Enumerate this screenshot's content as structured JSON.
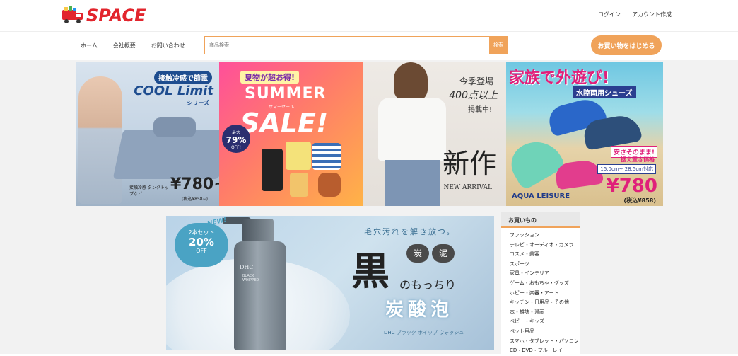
{
  "header": {
    "logo_text": "SPACE",
    "login": "ログイン",
    "create_account": "アカウント作成"
  },
  "nav": {
    "items": [
      "ホーム",
      "会社概要",
      "お問い合わせ"
    ]
  },
  "search": {
    "placeholder": "商品検索",
    "button": "検索"
  },
  "cta": {
    "label": "お買い物をはじめる"
  },
  "banners": [
    {
      "name": "COOL Limit",
      "tag": "接触冷感で節電",
      "title": "COOL Limit",
      "series": "シリーズ",
      "item": "接触冷感 タンクトップなど",
      "price": "¥780~",
      "tax": "(税込¥858~)"
    },
    {
      "name": "SUMMER SALE",
      "tag": "夏物が超お得!",
      "title1": "SUMMER",
      "sub": "サマーセール",
      "title2": "SALE!",
      "badge_top": "最大",
      "badge_value": "79%",
      "badge_bottom": "OFF!"
    },
    {
      "name": "新作",
      "line1": "今季登場",
      "line2": "400点以上",
      "line3": "掲載中!",
      "title": "新作",
      "sub": "NEW ARRIVAL"
    },
    {
      "name": "家族で外遊び",
      "title": "家族で外遊び!",
      "sub": "水陸両用シューズ",
      "tag1": "安さそのまま!",
      "tag2": "据え置き価格",
      "size": "15.0cm~ 28.5cm対応",
      "price": "¥780",
      "tax": "(税込¥858)",
      "brand": "AQUA LEISURE"
    }
  ],
  "main_banner": {
    "new": "NEW!",
    "badge_top": "2本セット",
    "badge_value": "20%",
    "badge_bottom": "OFF",
    "headline": "毛穴汚れを解き放つ。",
    "big": "黒",
    "coal1": "炭",
    "coal2": "泥",
    "mid": "のもっちり",
    "foam": "炭酸泡",
    "product": "DHC ブラック ホイップ ウォッシュ",
    "bottle_brand": "DHC",
    "bottle_text": "BLACK WHIPPED"
  },
  "sidebar": {
    "title": "お買いもの",
    "items": [
      "ファッション",
      "テレビ・オーディオ・カメラ",
      "コスメ・美容",
      "スポーツ",
      "家具・インテリア",
      "ゲーム・おもちゃ・グッズ",
      "ホビー・楽器・アート",
      "キッチン・日用品・その他",
      "本・雑誌・漫画",
      "ベビー・キッズ",
      "ペット用品",
      "スマホ・タブレット・パソコン",
      "CD・DVD・ブルーレイ"
    ]
  },
  "colors": {
    "brand_red": "#e2252d",
    "accent_orange": "#f0a35a"
  }
}
